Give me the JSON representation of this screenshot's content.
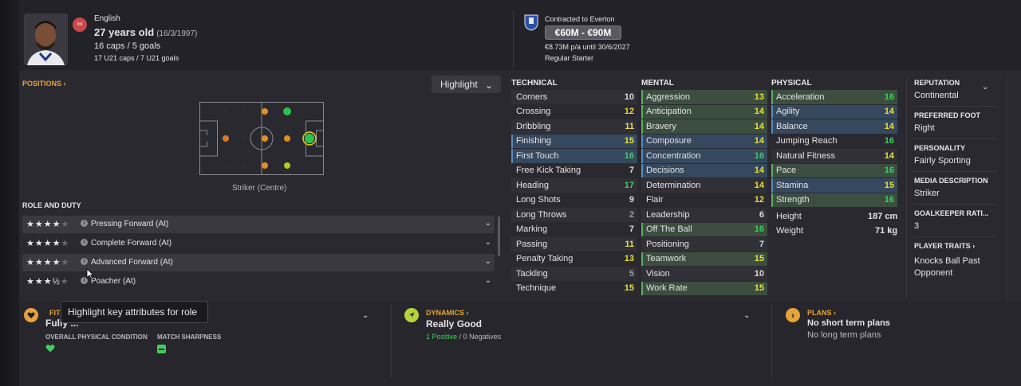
{
  "player": {
    "nationality_badge": "Int",
    "nationality": "English",
    "age": "27 years old",
    "dob": "(16/3/1997)",
    "caps": "16 caps / 5 goals",
    "u21": "17 U21 caps / 7 U21 goals"
  },
  "contract": {
    "club": "Contracted to Everton",
    "value": "€60M - €90M",
    "wage": "€8.73M p/a until 30/6/2027",
    "status": "Regular Starter"
  },
  "positions": {
    "header": "POSITIONS",
    "highlight_label": "Highlight",
    "position_label": "Striker (Centre)"
  },
  "roles": {
    "header": "ROLE AND DUTY",
    "items": [
      {
        "name": "Pressing Forward (At)",
        "stars": "★★★★",
        "stars_off": "★"
      },
      {
        "name": "Complete Forward (At)",
        "stars": "★★★★",
        "stars_off": "★"
      },
      {
        "name": "Advanced Forward (At)",
        "stars": "★★★★",
        "stars_off": "★"
      },
      {
        "name": "Poacher (At)",
        "stars": "★★★½",
        "stars_off": "★"
      }
    ]
  },
  "technical": {
    "header": "TECHNICAL",
    "attrs": [
      {
        "name": "Corners",
        "value": "10"
      },
      {
        "name": "Crossing",
        "value": "12"
      },
      {
        "name": "Dribbling",
        "value": "11"
      },
      {
        "name": "Finishing",
        "value": "15"
      },
      {
        "name": "First Touch",
        "value": "16"
      },
      {
        "name": "Free Kick Taking",
        "value": "7"
      },
      {
        "name": "Heading",
        "value": "17"
      },
      {
        "name": "Long Shots",
        "value": "9"
      },
      {
        "name": "Long Throws",
        "value": "2"
      },
      {
        "name": "Marking",
        "value": "7"
      },
      {
        "name": "Passing",
        "value": "11"
      },
      {
        "name": "Penalty Taking",
        "value": "13"
      },
      {
        "name": "Tackling",
        "value": "5"
      },
      {
        "name": "Technique",
        "value": "15"
      }
    ]
  },
  "mental": {
    "header": "MENTAL",
    "attrs": [
      {
        "name": "Aggression",
        "value": "13"
      },
      {
        "name": "Anticipation",
        "value": "14"
      },
      {
        "name": "Bravery",
        "value": "14"
      },
      {
        "name": "Composure",
        "value": "14"
      },
      {
        "name": "Concentration",
        "value": "16"
      },
      {
        "name": "Decisions",
        "value": "14"
      },
      {
        "name": "Determination",
        "value": "14"
      },
      {
        "name": "Flair",
        "value": "12"
      },
      {
        "name": "Leadership",
        "value": "6"
      },
      {
        "name": "Off The Ball",
        "value": "16"
      },
      {
        "name": "Positioning",
        "value": "7"
      },
      {
        "name": "Teamwork",
        "value": "15"
      },
      {
        "name": "Vision",
        "value": "10"
      },
      {
        "name": "Work Rate",
        "value": "15"
      }
    ]
  },
  "physical": {
    "header": "PHYSICAL",
    "attrs": [
      {
        "name": "Acceleration",
        "value": "16"
      },
      {
        "name": "Agility",
        "value": "14"
      },
      {
        "name": "Balance",
        "value": "14"
      },
      {
        "name": "Jumping Reach",
        "value": "16"
      },
      {
        "name": "Natural Fitness",
        "value": "14"
      },
      {
        "name": "Pace",
        "value": "16"
      },
      {
        "name": "Stamina",
        "value": "15"
      },
      {
        "name": "Strength",
        "value": "16"
      }
    ],
    "height_label": "Height",
    "height": "187 cm",
    "weight_label": "Weight",
    "weight": "71 kg"
  },
  "sidebar": {
    "reputation_h": "REPUTATION",
    "reputation": "Continental",
    "foot_h": "PREFERRED FOOT",
    "foot": "Right",
    "personality_h": "PERSONALITY",
    "personality": "Fairly Sporting",
    "media_h": "MEDIA DESCRIPTION",
    "media": "Striker",
    "gk_h": "GOALKEEPER RATI...",
    "gk": "3",
    "traits_h": "PLAYER TRAITS",
    "trait1": "Knocks Ball Past",
    "trait2": "Opponent"
  },
  "bottom": {
    "fit_h": "FIT",
    "fit_value": "Fully ...",
    "condition_label": "OVERALL PHYSICAL CONDITION",
    "sharpness_label": "MATCH SHARPNESS",
    "dynamics_h": "DYNAMICS",
    "dynamics_value": "Really Good",
    "positives": "1 Positive",
    "negatives": "0 Negatives",
    "plans_h": "PLANS",
    "plans1": "No short term plans",
    "plans2": "No long term plans"
  },
  "tooltip": "Highlight key attributes for role",
  "colors": {
    "accent_orange": "#e5a33a",
    "highlight_blue": "#35485d",
    "highlight_green": "#3b4e3f",
    "good_green": "#3ecf5e",
    "yellow": "#e8e23a"
  }
}
